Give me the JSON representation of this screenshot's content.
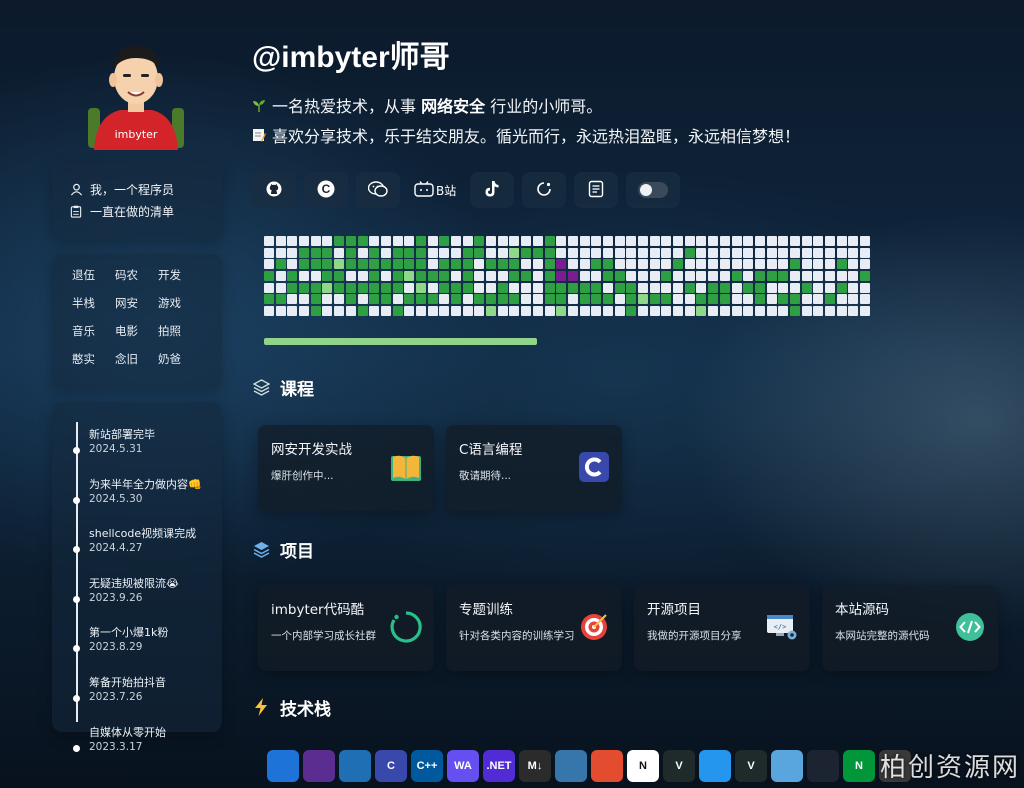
{
  "profile": {
    "title": "@imbyter师哥",
    "intro_line1_pre": "一名热爱技术，从事 ",
    "intro_line1_bold": "网络安全",
    "intro_line1_post": " 行业的小师哥。",
    "intro_line2": "喜欢分享技术，乐于结交朋友。循光而行，永远热泪盈眶，永远相信梦想！",
    "avatar_text": "imbyter"
  },
  "sidebar": {
    "links": [
      {
        "label": "我，一个程序员",
        "icon": "user-icon"
      },
      {
        "label": "一直在做的清单",
        "icon": "clipboard-icon"
      }
    ],
    "tags": [
      "退伍",
      "码农",
      "开发",
      "半栈",
      "网安",
      "游戏",
      "音乐",
      "电影",
      "拍照",
      "憨实",
      "念旧",
      "奶爸"
    ],
    "timeline": [
      {
        "title": "新站部署完毕",
        "date": "2024.5.31"
      },
      {
        "title": "为来半年全力做内容👊",
        "date": "2024.5.30"
      },
      {
        "title": "shellcode视频课完成",
        "date": "2024.4.27"
      },
      {
        "title": "无疑违规被限流😭",
        "date": "2023.9.26"
      },
      {
        "title": "第一个小爆1k粉",
        "date": "2023.8.29"
      },
      {
        "title": "筹备开始拍抖音",
        "date": "2023.7.26"
      },
      {
        "title": "自媒体从零开始",
        "date": "2023.3.17"
      }
    ]
  },
  "social": {
    "items": [
      "github-icon",
      "csdn-icon",
      "wechat-icon",
      "bilibili-icon",
      "douyin-icon",
      "refresh-icon",
      "document-icon",
      "theme-toggle"
    ],
    "bilibili_label": "B站"
  },
  "heatmap": {
    "rows": [
      "0000001110000101001000001000000000000000000000000000",
      "0001110101011100011002111000000000001000000000000000",
      "0101112111111101110111001400110000010000000001000100",
      "1010011001012111010001101440011000100000101110000001",
      "0011121111110201110010001111101100001011011000100100",
      "1100100101101110101111001101110121100111001011001000",
      "0000100010010000000200000200000100000200000001000000"
    ],
    "colors": {
      "0": "#e8ecf5",
      "1": "#2ea043",
      "2": "#8fd88a",
      "4": "#7a1d8f"
    },
    "progress": 0.44
  },
  "courses": {
    "heading": "课程",
    "items": [
      {
        "title": "网安开发实战",
        "desc": "爆肝创作中...",
        "icon": "book-icon"
      },
      {
        "title": "C语言编程",
        "desc": "敬请期待...",
        "icon": "c-lang-icon"
      }
    ]
  },
  "projects": {
    "heading": "项目",
    "items": [
      {
        "title": "imbyter代码酷",
        "desc": "一个内部学习成长社群",
        "icon": "spinner-ring-icon"
      },
      {
        "title": "专题训练",
        "desc": "针对各类内容的训练学习",
        "icon": "target-icon"
      },
      {
        "title": "开源项目",
        "desc": "我做的开源项目分享",
        "icon": "code-screen-icon"
      },
      {
        "title": "本站源码",
        "desc": "本网站完整的源代码",
        "icon": "code-brackets-icon"
      }
    ]
  },
  "stack": {
    "heading": "技术栈",
    "dock": [
      {
        "name": "windows-icon",
        "label": "",
        "color": "#1e73d8"
      },
      {
        "name": "visual-studio-icon",
        "label": "",
        "color": "#5c2d91"
      },
      {
        "name": "vscode-icon",
        "label": "",
        "color": "#1f6fb5"
      },
      {
        "name": "c-icon",
        "label": "C",
        "color": "#3949ab"
      },
      {
        "name": "cpp-icon",
        "label": "C++",
        "color": "#00599c"
      },
      {
        "name": "webassembly-icon",
        "label": "WA",
        "color": "#654ff0"
      },
      {
        "name": "dotnet-icon",
        "label": ".NET",
        "color": "#512bd4"
      },
      {
        "name": "markdown-icon",
        "label": "M↓",
        "color": "#2b2b2b"
      },
      {
        "name": "python-icon",
        "label": "",
        "color": "#3776ab"
      },
      {
        "name": "git-icon",
        "label": "",
        "color": "#e44c30"
      },
      {
        "name": "notion-icon",
        "label": "N",
        "color": "#ffffff"
      },
      {
        "name": "vue-icon",
        "label": "V",
        "color": "#1f2a2a"
      },
      {
        "name": "docker-icon",
        "label": "",
        "color": "#2496ed"
      },
      {
        "name": "vuetify-icon",
        "label": "V",
        "color": "#1f2a2a"
      },
      {
        "name": "sqlite-icon",
        "label": "",
        "color": "#58a6dd"
      },
      {
        "name": "mysql-icon",
        "label": "",
        "color": "#1b2430"
      },
      {
        "name": "nginx-icon",
        "label": "N",
        "color": "#009639"
      },
      {
        "name": "more-icon",
        "label": "",
        "color": "#3a3a3a"
      }
    ]
  },
  "watermark": "柏创资源网"
}
